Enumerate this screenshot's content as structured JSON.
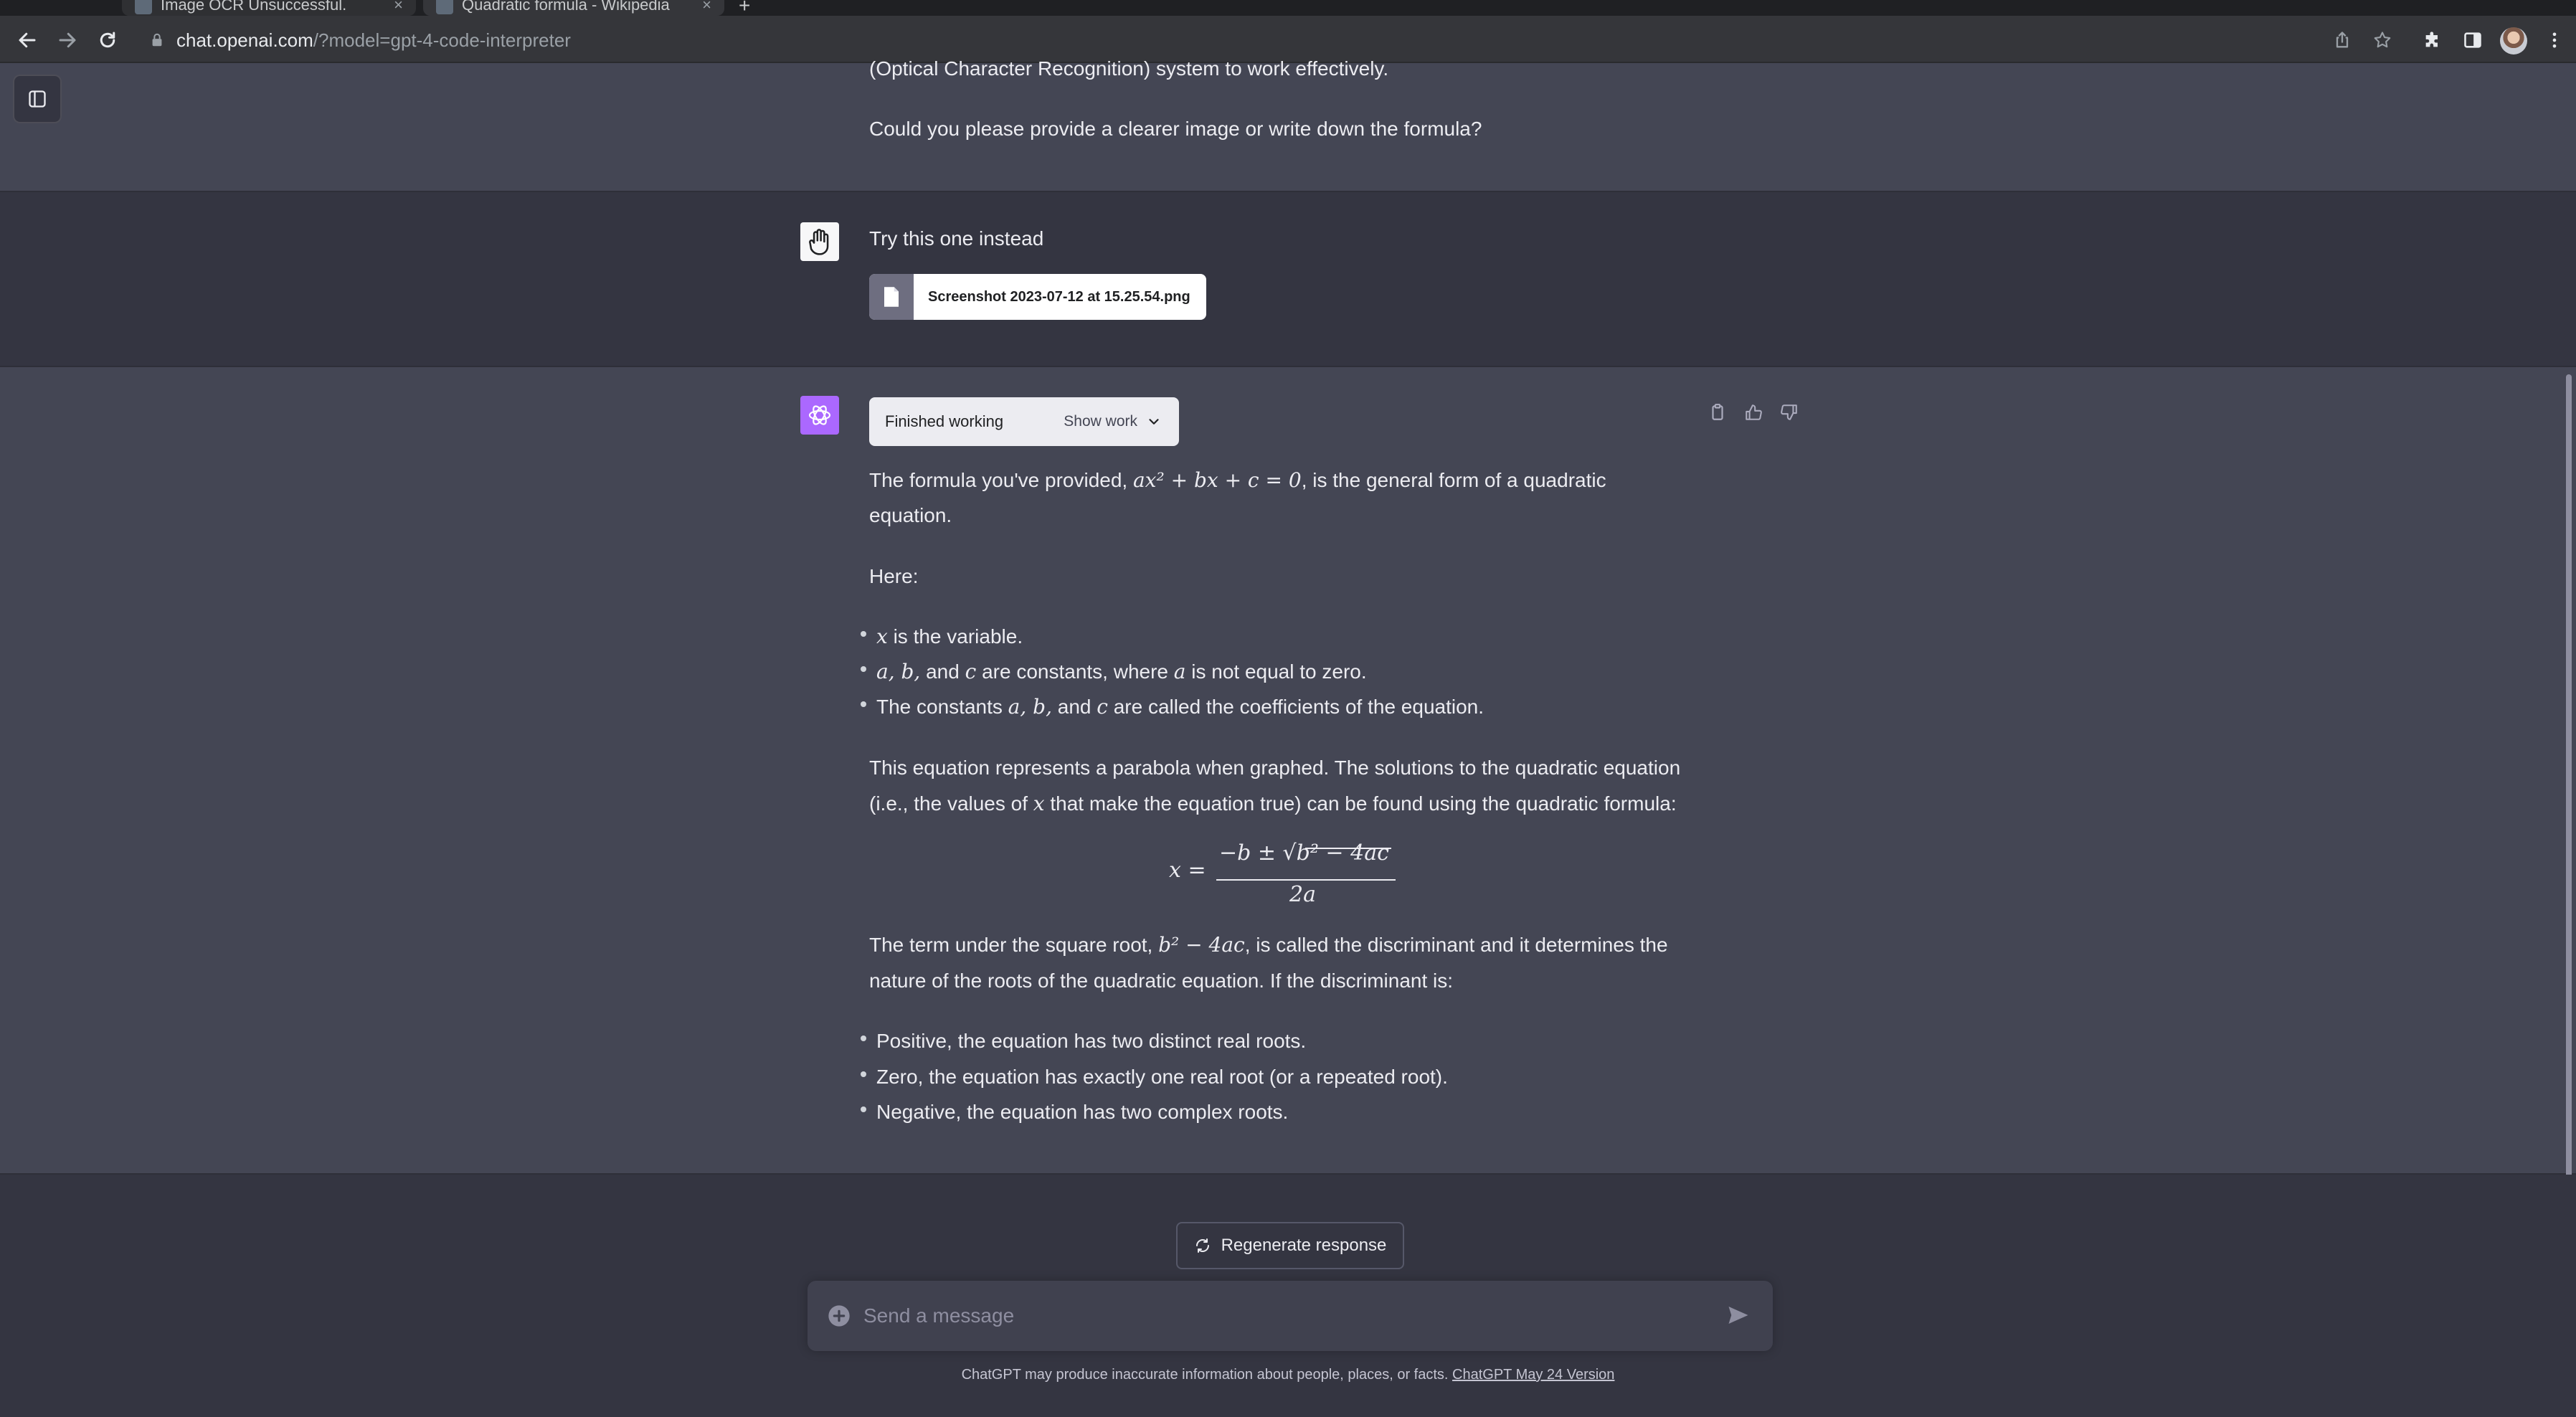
{
  "browser": {
    "tabs": [
      {
        "label": "Image OCR Unsuccessful.",
        "close": "×"
      },
      {
        "label": "Quadratic formula - Wikipedia",
        "close": "×"
      }
    ],
    "new_tab": "+",
    "url_host": "chat.openai.com",
    "url_path": "/?model=gpt-4-code-interpreter"
  },
  "conversation": {
    "prev_assistant": {
      "line1": "(Optical Character Recognition) system to work effectively.",
      "line2": "Could you please provide a clearer image or write down the formula?"
    },
    "user": {
      "text": "Try this one instead",
      "attachment": "Screenshot 2023-07-12 at 15.25.54.png"
    },
    "assistant": {
      "tool_status": "Finished working",
      "show_work": "Show work",
      "p1_a": "The formula you've provided, ",
      "p1_math": "ax² + bx + c = 0",
      "p1_b": ", is the general form of a quadratic",
      "p1_c": "equation.",
      "here": "Here:",
      "bullets_a": [
        {
          "math": "x",
          "text": " is the variable."
        },
        {
          "math": "a, b,",
          "text": " and ",
          "math2": "c",
          "text2": " are constants, where ",
          "math3": "a",
          "text3": " is not equal to zero."
        },
        {
          "text": "The constants ",
          "math": "a, b,",
          "text2": " and ",
          "math2": "c",
          "text3": " are called the coefficients of the equation."
        }
      ],
      "p2_line1": "This equation represents a parabola when graphed. The solutions to the quadratic equation",
      "p2_line2_a": "(i.e., the values of ",
      "p2_line2_math": "x",
      "p2_line2_b": " that make the equation true) can be found using the quadratic formula:",
      "formula": {
        "lhs": "x =",
        "numerator": "−b ± √b² − 4ac",
        "denominator": "2a"
      },
      "p3_a": "The term under the square root, ",
      "p3_math": "b² − 4ac",
      "p3_b": ", is called the discriminant and it determines the",
      "p3_c": "nature of the roots of the quadratic equation. If the discriminant is:",
      "bullets_b": [
        "Positive, the equation has two distinct real roots.",
        "Zero, the equation has exactly one real root (or a repeated root).",
        "Negative, the equation has two complex roots."
      ]
    }
  },
  "composer": {
    "regenerate": "Regenerate response",
    "placeholder": "Send a message",
    "disclaimer": "ChatGPT may produce inaccurate information about people, places, or facts.",
    "version_link": "ChatGPT May 24 Version"
  },
  "colors": {
    "page_bg": "#343541",
    "assistant_bg": "#444654",
    "gpt4_avatar": "#ab68ff",
    "browser_toolbar": "#35363a"
  }
}
